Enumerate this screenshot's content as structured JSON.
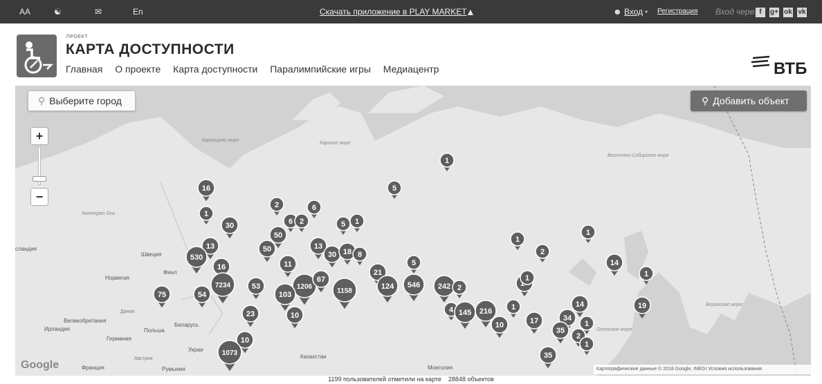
{
  "topbar": {
    "font_size": "AA",
    "language": "En",
    "app_download": "Скачать приложение в PLAY MARKET",
    "login": "Вход",
    "separator": "•",
    "register": "Регистрация",
    "login_via": "Вход через:",
    "social": [
      "f",
      "g+",
      "ok",
      "vk"
    ]
  },
  "header": {
    "project_label": "ПРОЕКТ",
    "title": "КАРТА ДОСТУПНОСТИ",
    "nav": [
      "Главная",
      "О проекте",
      "Карта доступности",
      "Паралимпийские игры",
      "Медиацентр"
    ],
    "sponsor": "ВТБ"
  },
  "map": {
    "choose_city": "Выберите город",
    "add_object": "Добавить объект",
    "zoom_in": "+",
    "zoom_out": "−",
    "google": "Google",
    "copyright": "Картографические данные © 2018 Google, INEGI   Условия использования",
    "labels": {
      "barents_sea": "Баренцево море",
      "kara_sea": "Карское море",
      "east_siberian_sea": "Восточно-Сибирское море",
      "norwegian_sea": "Norwegian Sea",
      "iceland": "сландия",
      "sweden": "Швеция",
      "finland": "Финл",
      "norway": "Норвегия",
      "denmark": "Дания",
      "great_britain": "Великобритания",
      "ireland": "Ирландия",
      "germany": "Германия",
      "poland": "Польша",
      "belarus": "Беларусь",
      "ukraine": "Украи",
      "austria": "Австрия",
      "france": "Франция",
      "romania": "Румыния",
      "kazakhstan": "Казахстан",
      "mongolia": "Монголия",
      "bering_sea": "Берингово море",
      "okhotsk_sea": "Охотское море"
    },
    "markers": [
      {
        "n": "16"
      },
      {
        "n": "1"
      },
      {
        "n": "30"
      },
      {
        "n": "2"
      },
      {
        "n": "6"
      },
      {
        "n": "6"
      },
      {
        "n": "2"
      },
      {
        "n": "5"
      },
      {
        "n": "1"
      },
      {
        "n": "50"
      },
      {
        "n": "13"
      },
      {
        "n": "530"
      },
      {
        "n": "50"
      },
      {
        "n": "13"
      },
      {
        "n": "30"
      },
      {
        "n": "18"
      },
      {
        "n": "8"
      },
      {
        "n": "16"
      },
      {
        "n": "11"
      },
      {
        "n": "7234"
      },
      {
        "n": "53"
      },
      {
        "n": "1206"
      },
      {
        "n": "67"
      },
      {
        "n": "1158"
      },
      {
        "n": "21"
      },
      {
        "n": "124"
      },
      {
        "n": "546"
      },
      {
        "n": "242"
      },
      {
        "n": "2"
      },
      {
        "n": "5"
      },
      {
        "n": "75"
      },
      {
        "n": "54"
      },
      {
        "n": "103"
      },
      {
        "n": "23"
      },
      {
        "n": "10"
      },
      {
        "n": "4"
      },
      {
        "n": "145"
      },
      {
        "n": "216"
      },
      {
        "n": "1"
      },
      {
        "n": "10"
      },
      {
        "n": "15"
      },
      {
        "n": "1"
      },
      {
        "n": "17"
      },
      {
        "n": "34"
      },
      {
        "n": "35"
      },
      {
        "n": "2"
      },
      {
        "n": "14"
      },
      {
        "n": "1"
      },
      {
        "n": "14"
      },
      {
        "n": "1"
      },
      {
        "n": "19"
      },
      {
        "n": "10"
      },
      {
        "n": "1073"
      },
      {
        "n": "35"
      },
      {
        "n": "1"
      },
      {
        "n": "1"
      },
      {
        "n": "5"
      },
      {
        "n": "2"
      },
      {
        "n": "1"
      },
      {
        "n": "1"
      }
    ]
  },
  "footer": {
    "users_text": "1199 пользователей отметили на карте",
    "objects_text": "28848 объектов"
  },
  "colors": {
    "topbar": "#3a3a3a",
    "marker": "#5e5e5e",
    "land": "#e7e7e7",
    "water": "#d2d2d2"
  }
}
